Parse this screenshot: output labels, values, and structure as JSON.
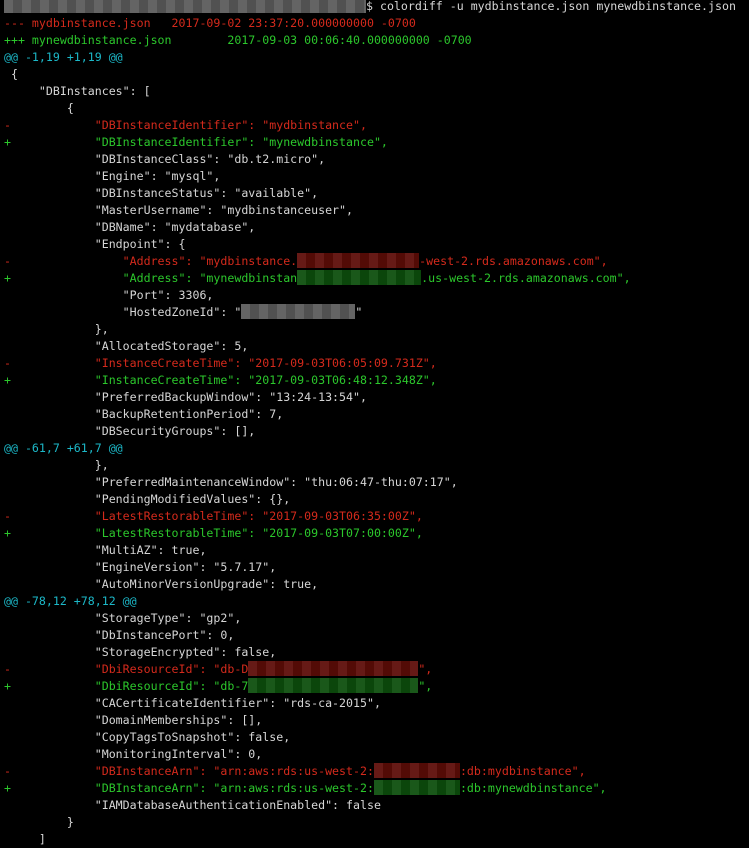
{
  "command": "$ colordiff -u mydbinstance.json mynewdbinstance.json",
  "colors": {
    "removed": "#d42a1c",
    "added": "#2cc72c",
    "hunk": "#1cb8c8",
    "text": "#d6d6d6",
    "background": "#000000"
  },
  "lines": [
    {
      "kind": "prompt",
      "segments": [
        {
          "redacted": true
        },
        {
          "text": "$ colordiff -u mydbinstance.json mynewdbinstance.json"
        }
      ]
    },
    {
      "kind": "del",
      "segments": [
        {
          "text": "--- mydbinstance.json   2017-09-02 23:37:20.000000000 -0700"
        }
      ]
    },
    {
      "kind": "add",
      "segments": [
        {
          "text": "+++ mynewdbinstance.json        2017-09-03 00:06:40.000000000 -0700"
        }
      ]
    },
    {
      "kind": "hunk",
      "segments": [
        {
          "text": "@@ -1,19 +1,19 @@"
        }
      ]
    },
    {
      "kind": "plain",
      "segments": [
        {
          "text": " {"
        }
      ]
    },
    {
      "kind": "plain",
      "segments": [
        {
          "text": "     \"DBInstances\": ["
        }
      ]
    },
    {
      "kind": "plain",
      "segments": [
        {
          "text": "         {"
        }
      ]
    },
    {
      "kind": "del",
      "segments": [
        {
          "text": "-            \"DBInstanceIdentifier\": \"mydbinstance\","
        }
      ]
    },
    {
      "kind": "add",
      "segments": [
        {
          "text": "+            \"DBInstanceIdentifier\": \"mynewdbinstance\","
        }
      ]
    },
    {
      "kind": "plain",
      "segments": [
        {
          "text": "             \"DBInstanceClass\": \"db.t2.micro\","
        }
      ]
    },
    {
      "kind": "plain",
      "segments": [
        {
          "text": "             \"Engine\": \"mysql\","
        }
      ]
    },
    {
      "kind": "plain",
      "segments": [
        {
          "text": "             \"DBInstanceStatus\": \"available\","
        }
      ]
    },
    {
      "kind": "plain",
      "segments": [
        {
          "text": "             \"MasterUsername\": \"mydbinstanceuser\","
        }
      ]
    },
    {
      "kind": "plain",
      "segments": [
        {
          "text": "             \"DBName\": \"mydatabase\","
        }
      ]
    },
    {
      "kind": "plain",
      "segments": [
        {
          "text": "             \"Endpoint\": {"
        }
      ]
    },
    {
      "kind": "del",
      "segments": [
        {
          "text": "-                \"Address\": \"mydbinstance."
        },
        {
          "redacted": true
        },
        {
          "text": "-west-2.rds.amazonaws.com\","
        }
      ]
    },
    {
      "kind": "add",
      "segments": [
        {
          "text": "+                \"Address\": \"mynewdbinstan"
        },
        {
          "redacted": true
        },
        {
          "text": ".us-west-2.rds.amazonaws.com\","
        }
      ]
    },
    {
      "kind": "plain",
      "segments": [
        {
          "text": "                 \"Port\": 3306,"
        }
      ]
    },
    {
      "kind": "plain",
      "segments": [
        {
          "text": "                 \"HostedZoneId\": \""
        },
        {
          "redacted": true
        },
        {
          "text": "\""
        }
      ]
    },
    {
      "kind": "plain",
      "segments": [
        {
          "text": "             },"
        }
      ]
    },
    {
      "kind": "plain",
      "segments": [
        {
          "text": "             \"AllocatedStorage\": 5,"
        }
      ]
    },
    {
      "kind": "del",
      "segments": [
        {
          "text": "-            \"InstanceCreateTime\": \"2017-09-03T06:05:09.731Z\","
        }
      ]
    },
    {
      "kind": "add",
      "segments": [
        {
          "text": "+            \"InstanceCreateTime\": \"2017-09-03T06:48:12.348Z\","
        }
      ]
    },
    {
      "kind": "plain",
      "segments": [
        {
          "text": "             \"PreferredBackupWindow\": \"13:24-13:54\","
        }
      ]
    },
    {
      "kind": "plain",
      "segments": [
        {
          "text": "             \"BackupRetentionPeriod\": 7,"
        }
      ]
    },
    {
      "kind": "plain",
      "segments": [
        {
          "text": "             \"DBSecurityGroups\": [],"
        }
      ]
    },
    {
      "kind": "hunk",
      "segments": [
        {
          "text": "@@ -61,7 +61,7 @@"
        }
      ]
    },
    {
      "kind": "plain",
      "segments": [
        {
          "text": "             },"
        }
      ]
    },
    {
      "kind": "plain",
      "segments": [
        {
          "text": "             \"PreferredMaintenanceWindow\": \"thu:06:47-thu:07:17\","
        }
      ]
    },
    {
      "kind": "plain",
      "segments": [
        {
          "text": "             \"PendingModifiedValues\": {},"
        }
      ]
    },
    {
      "kind": "del",
      "segments": [
        {
          "text": "-            \"LatestRestorableTime\": \"2017-09-03T06:35:00Z\","
        }
      ]
    },
    {
      "kind": "add",
      "segments": [
        {
          "text": "+            \"LatestRestorableTime\": \"2017-09-03T07:00:00Z\","
        }
      ]
    },
    {
      "kind": "plain",
      "segments": [
        {
          "text": "             \"MultiAZ\": true,"
        }
      ]
    },
    {
      "kind": "plain",
      "segments": [
        {
          "text": "             \"EngineVersion\": \"5.7.17\","
        }
      ]
    },
    {
      "kind": "plain",
      "segments": [
        {
          "text": "             \"AutoMinorVersionUpgrade\": true,"
        }
      ]
    },
    {
      "kind": "hunk",
      "segments": [
        {
          "text": "@@ -78,12 +78,12 @@"
        }
      ]
    },
    {
      "kind": "plain",
      "segments": [
        {
          "text": "             \"StorageType\": \"gp2\","
        }
      ]
    },
    {
      "kind": "plain",
      "segments": [
        {
          "text": "             \"DbInstancePort\": 0,"
        }
      ]
    },
    {
      "kind": "plain",
      "segments": [
        {
          "text": "             \"StorageEncrypted\": false,"
        }
      ]
    },
    {
      "kind": "del",
      "segments": [
        {
          "text": "-            \"DbiResourceId\": \"db-D"
        },
        {
          "redacted": true
        },
        {
          "text": "\","
        }
      ]
    },
    {
      "kind": "add",
      "segments": [
        {
          "text": "+            \"DbiResourceId\": \"db-7"
        },
        {
          "redacted": true
        },
        {
          "text": "\","
        }
      ]
    },
    {
      "kind": "plain",
      "segments": [
        {
          "text": "             \"CACertificateIdentifier\": \"rds-ca-2015\","
        }
      ]
    },
    {
      "kind": "plain",
      "segments": [
        {
          "text": "             \"DomainMemberships\": [],"
        }
      ]
    },
    {
      "kind": "plain",
      "segments": [
        {
          "text": "             \"CopyTagsToSnapshot\": false,"
        }
      ]
    },
    {
      "kind": "plain",
      "segments": [
        {
          "text": "             \"MonitoringInterval\": 0,"
        }
      ]
    },
    {
      "kind": "del",
      "segments": [
        {
          "text": "-            \"DBInstanceArn\": \"arn:aws:rds:us-west-2:"
        },
        {
          "redacted": true
        },
        {
          "text": ":db:mydbinstance\","
        }
      ]
    },
    {
      "kind": "add",
      "segments": [
        {
          "text": "+            \"DBInstanceArn\": \"arn:aws:rds:us-west-2:"
        },
        {
          "redacted": true
        },
        {
          "text": ":db:mynewdbinstance\","
        }
      ]
    },
    {
      "kind": "plain",
      "segments": [
        {
          "text": "             \"IAMDatabaseAuthenticationEnabled\": false"
        }
      ]
    },
    {
      "kind": "plain",
      "segments": [
        {
          "text": "         }"
        }
      ]
    },
    {
      "kind": "plain",
      "segments": [
        {
          "text": "     ]"
        }
      ]
    }
  ]
}
